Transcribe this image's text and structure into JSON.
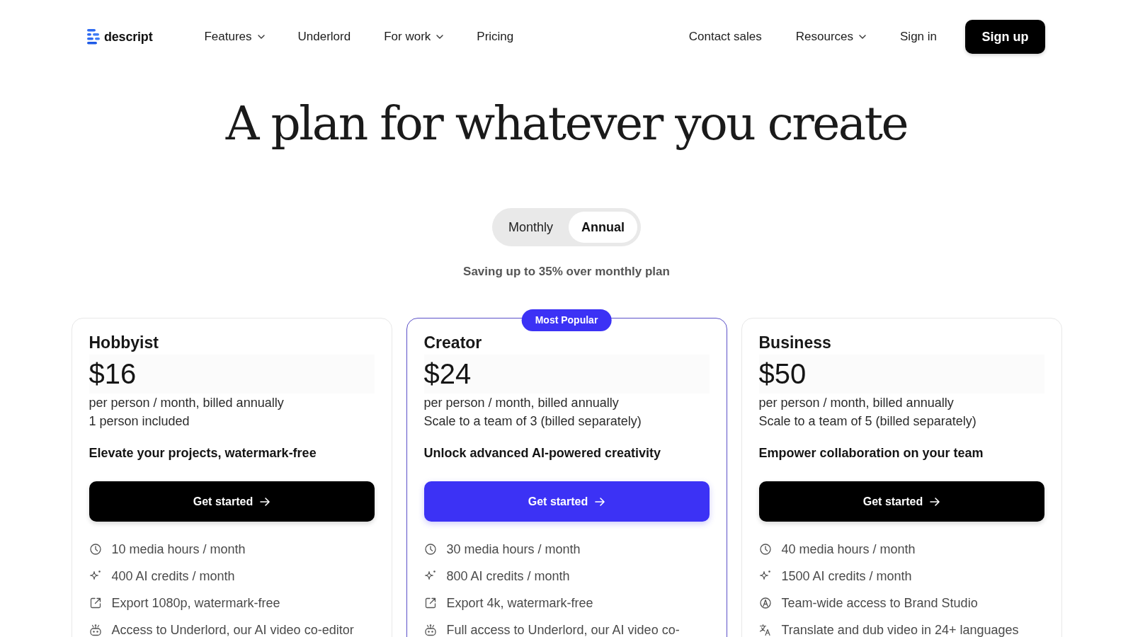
{
  "nav": {
    "logo": "descript",
    "links": [
      {
        "label": "Features",
        "dropdown": true
      },
      {
        "label": "Underlord",
        "dropdown": false
      },
      {
        "label": "For work",
        "dropdown": true
      },
      {
        "label": "Pricing",
        "dropdown": false
      }
    ],
    "right_links": [
      {
        "label": "Contact sales",
        "dropdown": false
      },
      {
        "label": "Resources",
        "dropdown": true
      },
      {
        "label": "Sign in",
        "dropdown": false
      }
    ],
    "signup_button": "Sign up"
  },
  "heading": "A plan for whatever you create",
  "billing_toggle": [
    {
      "label": "Monthly",
      "selected": false
    },
    {
      "label": "Annual",
      "selected": true
    }
  ],
  "savings_note": "Saving up to 35% over monthly plan",
  "plans": [
    {
      "name": "Hobbyist",
      "highlighted": false,
      "price": "$16",
      "billing": "per person / month, billed annually",
      "seats": "1 person included",
      "tagline": "Elevate your projects, watermark-free",
      "button": "Get started",
      "features": [
        {
          "kind": "clock",
          "text": "10 media hours / month"
        },
        {
          "kind": "sparkle",
          "text": "400 AI credits / month"
        },
        {
          "kind": "export",
          "text": "Export 1080p, watermark-free"
        },
        {
          "kind": "robot",
          "text": "Access to Underlord, our AI video co-editor"
        }
      ]
    },
    {
      "name": "Creator",
      "badge": "Most Popular",
      "highlighted": true,
      "price": "$24",
      "billing": "per person / month, billed annually",
      "seats": "Scale to a team of 3 (billed separately)",
      "tagline": "Unlock advanced AI-powered creativity",
      "button": "Get started",
      "features": [
        {
          "kind": "clock",
          "text": "30 media hours / month"
        },
        {
          "kind": "sparkle",
          "text": "800 AI credits / month"
        },
        {
          "kind": "export",
          "text": "Export 4k, watermark-free"
        },
        {
          "kind": "robot",
          "text": "Full access to Underlord, our AI video co-"
        }
      ]
    },
    {
      "name": "Business",
      "highlighted": false,
      "price": "$50",
      "billing": "per person / month, billed annually",
      "seats": "Scale to a team of 5 (billed separately)",
      "tagline": "Empower collaboration on your team",
      "button": "Get started",
      "features": [
        {
          "kind": "clock",
          "text": "40 media hours / month"
        },
        {
          "kind": "sparkle",
          "text": "1500 AI credits / month"
        },
        {
          "kind": "brand",
          "text": "Team-wide access to Brand Studio"
        },
        {
          "kind": "translate",
          "text": "Translate and dub video in 24+ languages"
        }
      ]
    }
  ]
}
